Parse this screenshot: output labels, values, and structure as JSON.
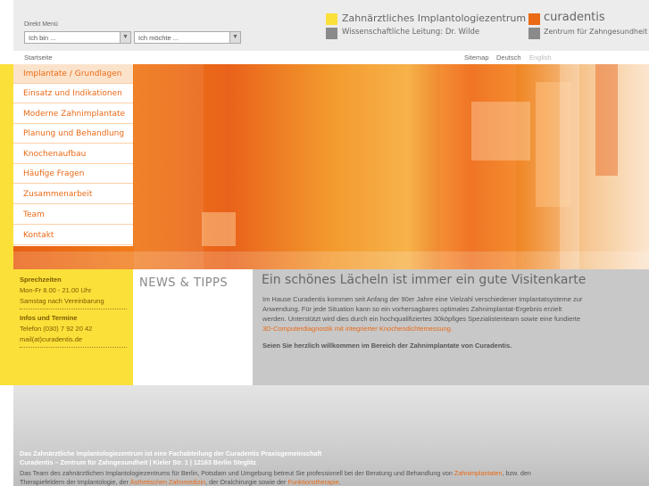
{
  "header": {
    "direkt_label": "Direkt Menü",
    "select1": "Ich bin ...",
    "select2": "Ich möchte ...",
    "logo1_line1": "Zahnärztliches Implantologiezentrum",
    "logo1_line2": "Wissenschaftliche Leitung: Dr. Wilde",
    "logo2_line1": "curadentis",
    "logo2_line2": "Zentrum für Zahngesundheit",
    "colors": {
      "logo_yellow": "#fce03a",
      "logo_orange": "#ea6a16",
      "logo_gray": "#8a8a8a"
    }
  },
  "subbar": {
    "startseite": "Startseite",
    "sitemap": "Sitemap",
    "deutsch": "Deutsch",
    "english": "English"
  },
  "nav": {
    "items": [
      "Implantate / Grundlagen",
      "Einsatz und Indikationen",
      "Moderne Zahnimplantate",
      "Planung und Behandlung",
      "Knochenaufbau",
      "Häufige Fragen",
      "Zusammenarbeit",
      "Team",
      "Kontakt"
    ]
  },
  "contact": {
    "sprechzeiten_head": "Sprechzeiten",
    "hours1": "Mon-Fr 8.00 - 21.00 Uhr",
    "hours2": "Samstag nach Vereinbarung",
    "infos_head": "Infos und Termine",
    "phone": "Telefon (030) 7 92 20 42",
    "mail": "mail(at)curadentis.de"
  },
  "news": {
    "title": "NEWS & TIPPS"
  },
  "main": {
    "title": "Ein schönes Lächeln ist immer ein gute Visitenkarte",
    "p1": "Im Hause Curadentis kommen seit Anfang der 90er Jahre eine Vielzahl verschiedener Implantatsysteme zur",
    "p2": "Anwendung. Für jede Situation kann so ein vorhersagbares optimales Zahnimplantat-Ergebnis erzielt",
    "p3": "werden. Unterstützt wird dies durch ein hochqualifiziertes 30köpfiges Spezialistenteam sowie eine fundierte",
    "p4_link": "3D-Computerdiagnostik mit integrierter Knochendichtemessung.",
    "bold": "Seien Sie herzlich willkommen im Bereich der Zahnimplantate von Curadentis."
  },
  "footer": {
    "line1": "Das Zahnärztliche Implantologiezentrum ist eine Fachabteilung der Curadentis Praxisgemeinschaft",
    "line2": "Curadentis – Zentrum für Zahngesundheit  |  Kieler Str. 1  |  12163 Berlin Steglitz",
    "p_a": "Das Team des zahnärztlichen Implantologiezentrums für Berlin, Potsdam und Umgebung betreut Sie professionell bei der Beratung und Behandlung von ",
    "p_link1": "Zahnimplantaten",
    "p_b": ", bzw. den",
    "p_c": "Therapiefeldern der Implantologie, der ",
    "p_link2": "Ästhetischen Zahnmedizin",
    "p_d": ", der Oralchirurgie sowie der ",
    "p_link3": "Funktionstherapie",
    "p_e": "."
  }
}
